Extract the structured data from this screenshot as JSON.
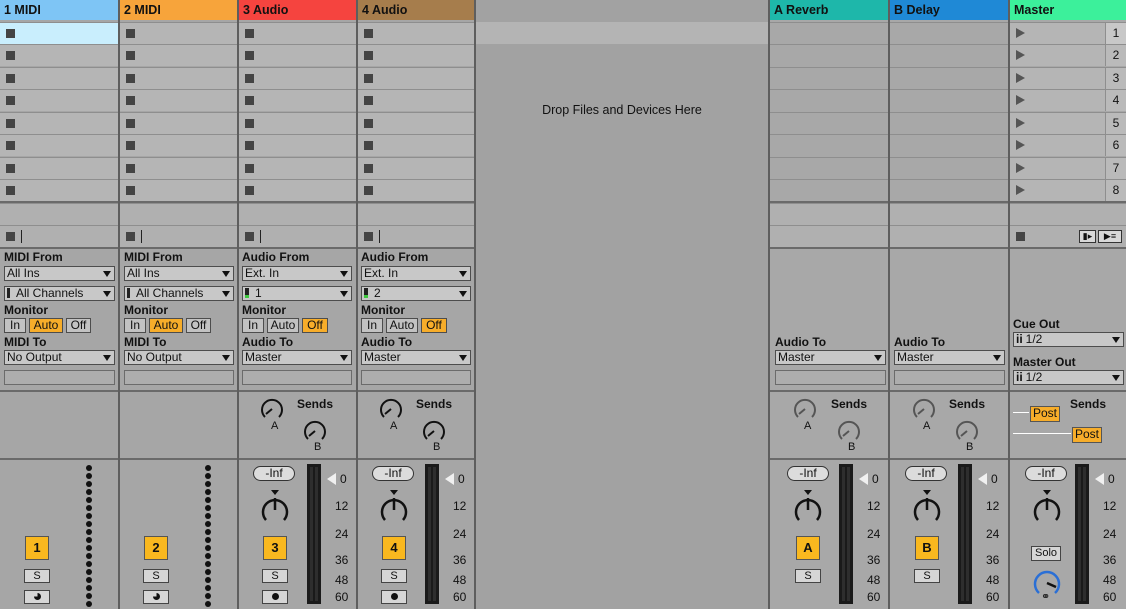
{
  "tracks": [
    {
      "name": "1 MIDI",
      "color": "#7ec5f5",
      "type": "midi",
      "number": "1",
      "from_label": "MIDI From",
      "from_value": "All Ins",
      "channel": "All Channels",
      "monitor_label": "Monitor",
      "monitor": [
        "In",
        "Auto",
        "Off"
      ],
      "monitor_active": 1,
      "to_label": "MIDI To",
      "to_value": "No Output",
      "solo": "S"
    },
    {
      "name": "2 MIDI",
      "color": "#f7a43b",
      "type": "midi",
      "number": "2",
      "from_label": "MIDI From",
      "from_value": "All Ins",
      "channel": "All Channels",
      "monitor_label": "Monitor",
      "monitor": [
        "In",
        "Auto",
        "Off"
      ],
      "monitor_active": 1,
      "to_label": "MIDI To",
      "to_value": "No Output",
      "solo": "S"
    },
    {
      "name": "3 Audio",
      "color": "#f5443f",
      "type": "audio",
      "number": "3",
      "from_label": "Audio From",
      "from_value": "Ext. In",
      "channel": "1",
      "monitor_label": "Monitor",
      "monitor": [
        "In",
        "Auto",
        "Off"
      ],
      "monitor_active": 2,
      "to_label": "Audio To",
      "to_value": "Master",
      "solo": "S",
      "volume": "-Inf",
      "sends_label": "Sends",
      "send_a": "A",
      "send_b": "B"
    },
    {
      "name": "4 Audio",
      "color": "#a67d4c",
      "type": "audio",
      "number": "4",
      "from_label": "Audio From",
      "from_value": "Ext. In",
      "channel": "2",
      "monitor_label": "Monitor",
      "monitor": [
        "In",
        "Auto",
        "Off"
      ],
      "monitor_active": 2,
      "to_label": "Audio To",
      "to_value": "Master",
      "solo": "S",
      "volume": "-Inf",
      "sends_label": "Sends",
      "send_a": "A",
      "send_b": "B"
    }
  ],
  "dropzone": {
    "message": "Drop Files and Devices Here"
  },
  "returns": [
    {
      "name": "A Reverb",
      "color": "#1eb7aa",
      "letter": "A",
      "to_label": "Audio To",
      "to_value": "Master",
      "volume": "-Inf",
      "sends_label": "Sends",
      "send_a": "A",
      "send_b": "B",
      "solo": "S"
    },
    {
      "name": "B Delay",
      "color": "#1f89d6",
      "letter": "B",
      "to_label": "Audio To",
      "to_value": "Master",
      "volume": "-Inf",
      "sends_label": "Sends",
      "send_a": "A",
      "send_b": "B",
      "solo": "S"
    }
  ],
  "master": {
    "name": "Master",
    "color": "#3cf09b",
    "scenes": [
      "1",
      "2",
      "3",
      "4",
      "5",
      "6",
      "7",
      "8"
    ],
    "cue_label": "Cue Out",
    "cue_value": "1/2",
    "out_label": "Master Out",
    "out_value": "1/2",
    "sends_label": "Sends",
    "post1": "Post",
    "post2": "Post",
    "volume": "-Inf",
    "solo": "Solo"
  },
  "meter_scale": [
    "0",
    "12",
    "24",
    "36",
    "48",
    "60"
  ]
}
